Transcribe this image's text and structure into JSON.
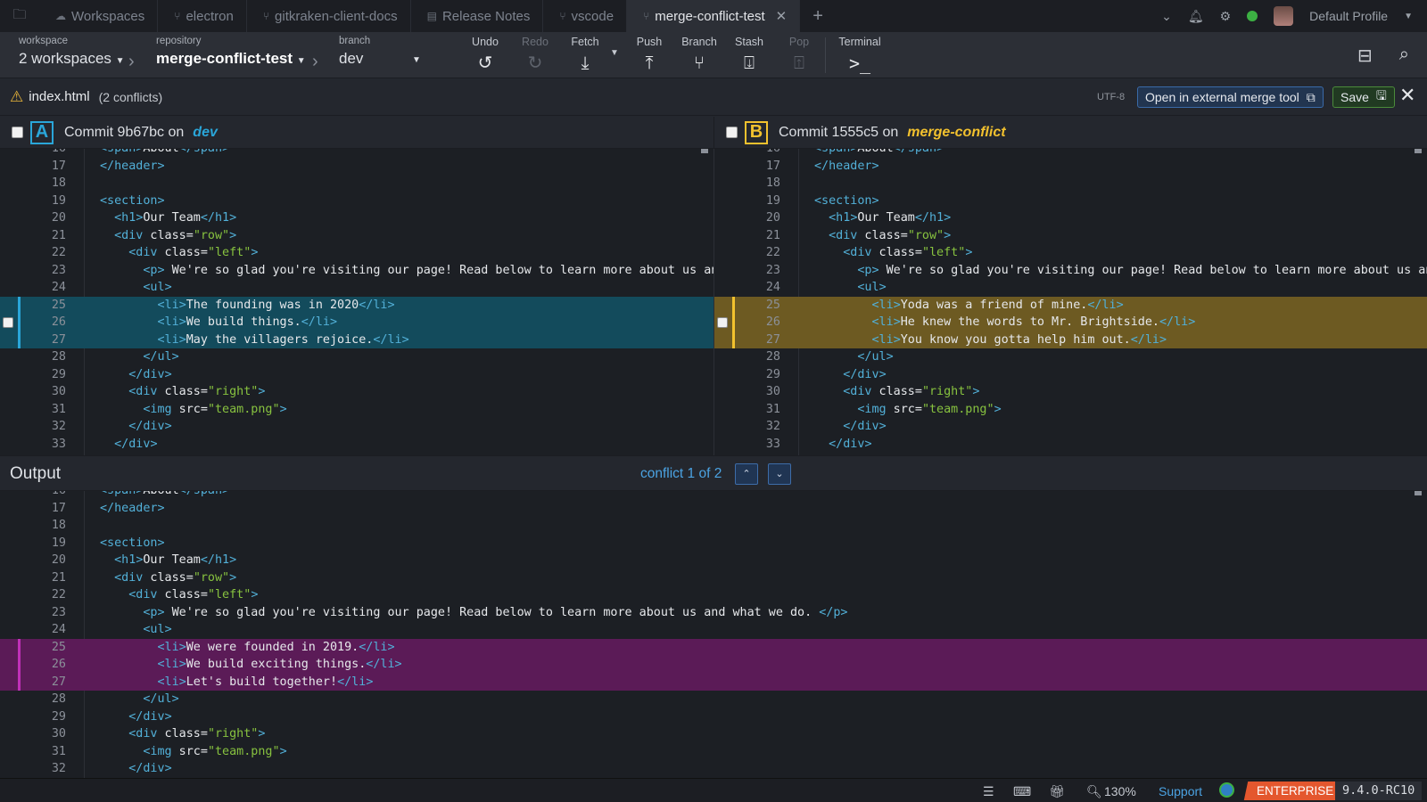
{
  "tabs": [
    {
      "label": "Workspaces",
      "icon": "cloud-icon",
      "active": false
    },
    {
      "label": "electron",
      "icon": "repo-icon",
      "active": false
    },
    {
      "label": "gitkraken-client-docs",
      "icon": "repo-icon",
      "active": false
    },
    {
      "label": "Release Notes",
      "icon": "document-icon",
      "active": false
    },
    {
      "label": "vscode",
      "icon": "repo-icon",
      "active": false
    },
    {
      "label": "merge-conflict-test",
      "icon": "repo-icon",
      "active": true
    }
  ],
  "profile": {
    "name": "Default Profile"
  },
  "toolbar": {
    "workspace_label": "workspace",
    "workspace_value": "2 workspaces",
    "repository_label": "repository",
    "repository_value": "merge-conflict-test",
    "branch_label": "branch",
    "branch_value": "dev",
    "undo": "Undo",
    "redo": "Redo",
    "fetch": "Fetch",
    "push": "Push",
    "branch": "Branch",
    "stash": "Stash",
    "pop": "Pop",
    "terminal": "Terminal"
  },
  "file": {
    "name": "index.html",
    "conflicts": "(2 conflicts)",
    "encoding": "UTF-8",
    "external_button": "Open in external merge tool",
    "save_button": "Save"
  },
  "pane_a": {
    "badge": "A",
    "commit": "Commit 9b67bc on",
    "branch": "dev"
  },
  "pane_b": {
    "badge": "B",
    "commit": "Commit 1555c5 on",
    "branch": "merge-conflict"
  },
  "output": {
    "title": "Output",
    "conflict_nav": "conflict 1 of 2"
  },
  "code_a": [
    {
      "n": "16",
      "t": "<span>About</span>"
    },
    {
      "n": "17",
      "t": "</header>"
    },
    {
      "n": "18",
      "t": ""
    },
    {
      "n": "19",
      "t": "<section>"
    },
    {
      "n": "20",
      "t": "  <h1>Our Team</h1>"
    },
    {
      "n": "21",
      "t": "  <div class=\"row\">"
    },
    {
      "n": "22",
      "t": "    <div class=\"left\">"
    },
    {
      "n": "23",
      "t": "      <p> We're so glad you're visiting our page! Read below to learn more about us and what we do. </p>"
    },
    {
      "n": "24",
      "t": "      <ul>"
    },
    {
      "n": "25",
      "t": "        <li>The founding was in 2020</li>",
      "hl": true
    },
    {
      "n": "26",
      "t": "        <li>We build things.</li>",
      "hl": true
    },
    {
      "n": "27",
      "t": "        <li>May the villagers rejoice.</li>",
      "hl": true
    },
    {
      "n": "28",
      "t": "      </ul>"
    },
    {
      "n": "29",
      "t": "    </div>"
    },
    {
      "n": "30",
      "t": "    <div class=\"right\">"
    },
    {
      "n": "31",
      "t": "      <img src=\"team.png\">"
    },
    {
      "n": "32",
      "t": "    </div>"
    },
    {
      "n": "33",
      "t": "  </div>"
    }
  ],
  "code_b": [
    {
      "n": "16",
      "t": "<span>About</span>"
    },
    {
      "n": "17",
      "t": "</header>"
    },
    {
      "n": "18",
      "t": ""
    },
    {
      "n": "19",
      "t": "<section>"
    },
    {
      "n": "20",
      "t": "  <h1>Our Team</h1>"
    },
    {
      "n": "21",
      "t": "  <div class=\"row\">"
    },
    {
      "n": "22",
      "t": "    <div class=\"left\">"
    },
    {
      "n": "23",
      "t": "      <p> We're so glad you're visiting our page! Read below to learn more about us and what we do. </p>"
    },
    {
      "n": "24",
      "t": "      <ul>"
    },
    {
      "n": "25",
      "t": "        <li>Yoda was a friend of mine.</li>",
      "hl": true
    },
    {
      "n": "26",
      "t": "        <li>He knew the words to Mr. Brightside.</li>",
      "hl": true
    },
    {
      "n": "27",
      "t": "        <li>You know you gotta help him out.</li>",
      "hl": true
    },
    {
      "n": "28",
      "t": "      </ul>"
    },
    {
      "n": "29",
      "t": "    </div>"
    },
    {
      "n": "30",
      "t": "    <div class=\"right\">"
    },
    {
      "n": "31",
      "t": "      <img src=\"team.png\">"
    },
    {
      "n": "32",
      "t": "    </div>"
    },
    {
      "n": "33",
      "t": "  </div>"
    }
  ],
  "code_out": [
    {
      "n": "16",
      "t": "<span>About</span>"
    },
    {
      "n": "17",
      "t": "</header>"
    },
    {
      "n": "18",
      "t": ""
    },
    {
      "n": "19",
      "t": "<section>"
    },
    {
      "n": "20",
      "t": "  <h1>Our Team</h1>"
    },
    {
      "n": "21",
      "t": "  <div class=\"row\">"
    },
    {
      "n": "22",
      "t": "    <div class=\"left\">"
    },
    {
      "n": "23",
      "t": "      <p> We're so glad you're visiting our page! Read below to learn more about us and what we do. </p>"
    },
    {
      "n": "24",
      "t": "      <ul>"
    },
    {
      "n": "25",
      "t": "        <li>We were founded in 2019.</li>",
      "hl": true
    },
    {
      "n": "26",
      "t": "        <li>We build exciting things.</li>",
      "hl": true
    },
    {
      "n": "27",
      "t": "        <li>Let's build together!</li>",
      "hl": true
    },
    {
      "n": "28",
      "t": "      </ul>"
    },
    {
      "n": "29",
      "t": "    </div>"
    },
    {
      "n": "30",
      "t": "    <div class=\"right\">"
    },
    {
      "n": "31",
      "t": "      <img src=\"team.png\">"
    },
    {
      "n": "32",
      "t": "    </div>"
    }
  ],
  "status": {
    "zoom": "130%",
    "support": "Support",
    "edition": "ENTERPRISE",
    "version": "9.4.0-RC10"
  },
  "colors": {
    "pane_a": "#2aa6d9",
    "pane_b": "#f2c12e",
    "output": "#c030b8",
    "enterprise": "#e4572e"
  }
}
